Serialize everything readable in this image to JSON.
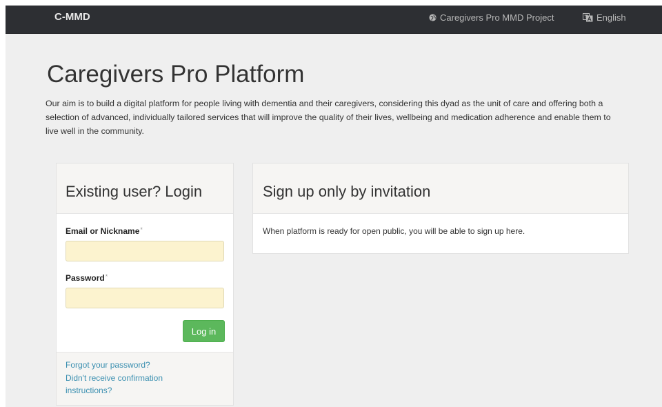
{
  "navbar": {
    "brand": "C-MMD",
    "project_link": "Caregivers Pro MMD Project",
    "language": "English",
    "bg_color": "#2d2f33"
  },
  "header": {
    "title": "Caregivers Pro Platform",
    "intro": "Our aim is to build a digital platform for people living with dementia and their caregivers, considering this dyad as the unit of care and offering both a selection of advanced, individually tailored services that will improve the quality of their lives, wellbeing and medication adherence and enable them to live well in the community."
  },
  "login": {
    "title": "Existing user? Login",
    "email_label": "Email or Nickname",
    "password_label": "Password",
    "required_mark": "*",
    "email_value": "",
    "password_value": "",
    "submit_label": "Log in",
    "forgot_link": "Forgot your password?",
    "confirm_link": "Didn't receive confirmation instructions?",
    "button_color": "#5cb85c",
    "input_bg": "#fcf3cf"
  },
  "signup": {
    "title": "Sign up only by invitation",
    "text": "When platform is ready for open public, you will be able to sign up here."
  },
  "icons": {
    "project": "globe-icon",
    "language": "language-flag-icon"
  }
}
